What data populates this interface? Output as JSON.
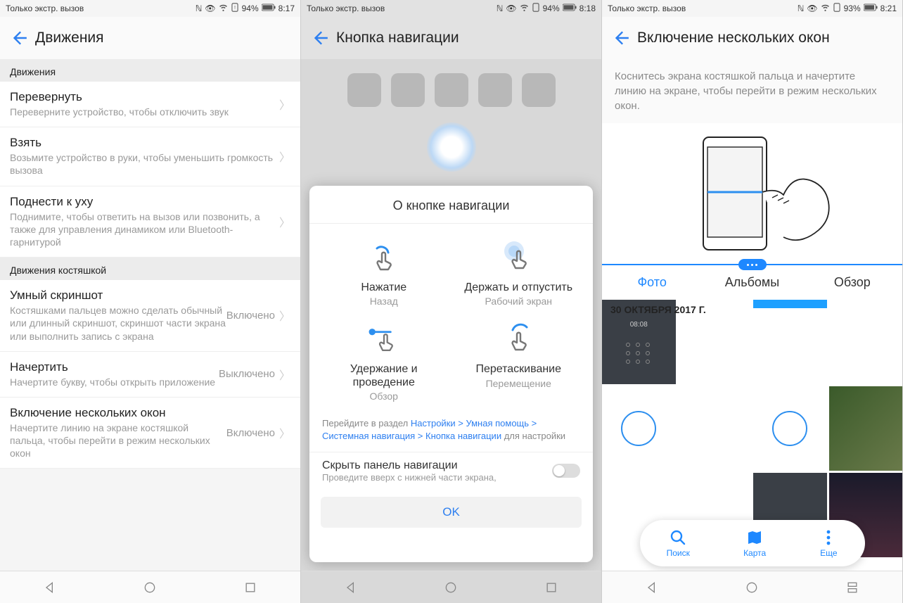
{
  "status": {
    "carrier": "Только экстр. вызов",
    "battery1": "94%",
    "time1": "8:17",
    "battery2": "94%",
    "time2": "8:18",
    "battery3": "93%",
    "time3": "8:21"
  },
  "screen1": {
    "title": "Движения",
    "section1": "Движения",
    "items1": [
      {
        "title": "Перевернуть",
        "sub": "Переверните устройство, чтобы отключить звук"
      },
      {
        "title": "Взять",
        "sub": "Возьмите устройство в руки, чтобы уменьшить громкость вызова"
      },
      {
        "title": "Поднести к уху",
        "sub": "Поднимите, чтобы ответить на вызов или позвонить, а также для управления динамиком или Bluetooth-гарнитурой"
      }
    ],
    "section2": "Движения костяшкой",
    "items2": [
      {
        "title": "Умный скриншот",
        "sub": "Костяшками пальцев можно сделать обычный или длинный скриншот, скриншот части экрана или выполнить запись с экрана",
        "value": "Включено"
      },
      {
        "title": "Начертить",
        "sub": "Начертите букву, чтобы открыть приложение",
        "value": "Выключено"
      },
      {
        "title": "Включение нескольких окон",
        "sub": "Начертите линию на экране костяшкой пальца, чтобы перейти в режим нескольких окон",
        "value": "Включено"
      }
    ]
  },
  "screen2": {
    "title": "Кнопка навигации",
    "modal_title": "О кнопке навигации",
    "gestures": [
      {
        "title": "Нажатие",
        "sub": "Назад"
      },
      {
        "title": "Держать и отпустить",
        "sub": "Рабочий экран"
      },
      {
        "title": "Удержание и проведение",
        "sub": "Обзор"
      },
      {
        "title": "Перетаскивание",
        "sub": "Перемещение"
      }
    ],
    "hint_prefix": "Перейдите в раздел ",
    "hint_link": "Настройки > Умная помощь > Системная навигация > Кнопка навигации",
    "hint_suffix": " для настройки",
    "toggle_title": "Скрыть панель навигации",
    "toggle_sub": "Проведите вверх с нижней части экрана,",
    "ok": "OK"
  },
  "screen3": {
    "title": "Включение нескольких окон",
    "desc": "Коснитесь экрана костяшкой пальца и начертите линию на экране, чтобы перейти в режим нескольких окон.",
    "tabs": [
      "Фото",
      "Альбомы",
      "Обзор"
    ],
    "date": "30 ОКТЯБРЯ 2017 Г.",
    "bottom": [
      {
        "label": "Поиск"
      },
      {
        "label": "Карта"
      },
      {
        "label": "Еще"
      }
    ]
  }
}
